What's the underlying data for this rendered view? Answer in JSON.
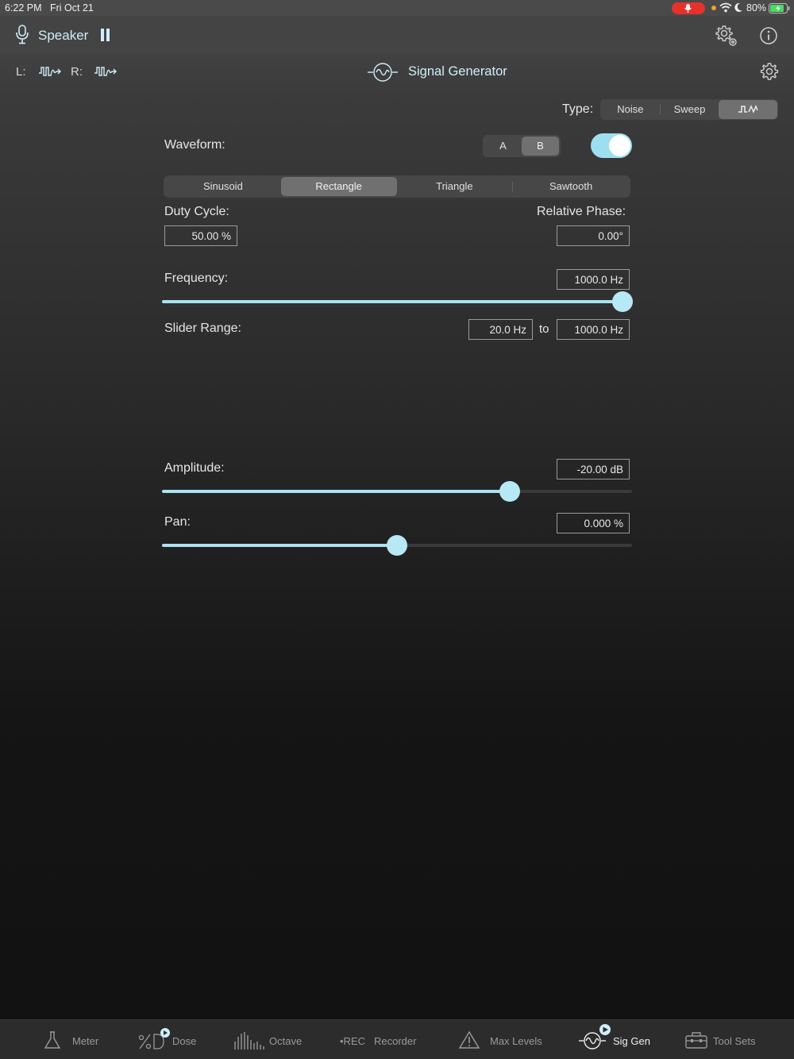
{
  "status_bar": {
    "time": "6:22 PM",
    "date": "Fri Oct 21",
    "battery": "80%"
  },
  "top_bar": {
    "output_label": "Speaker"
  },
  "sub_bar": {
    "left_label": "L:",
    "right_label": "R:",
    "title": "Signal Generator"
  },
  "type": {
    "label": "Type:",
    "options": [
      "Noise",
      "Sweep",
      "waveform-icon"
    ],
    "selected": 2
  },
  "waveform": {
    "label": "Waveform:",
    "ab_options": [
      "A",
      "B"
    ],
    "ab_selected": 1,
    "enabled": true,
    "shapes": [
      "Sinusoid",
      "Rectangle",
      "Triangle",
      "Sawtooth"
    ],
    "shape_selected": 1
  },
  "duty_cycle": {
    "label": "Duty Cycle:",
    "value": "50.00 %"
  },
  "relative_phase": {
    "label": "Relative Phase:",
    "value": "0.00°"
  },
  "frequency": {
    "label": "Frequency:",
    "value": "1000.0 Hz",
    "slider_fraction": 0.98
  },
  "slider_range": {
    "label": "Slider Range:",
    "from": "20.0 Hz",
    "to_label": "to",
    "to": "1000.0 Hz"
  },
  "amplitude": {
    "label": "Amplitude:",
    "value": "-20.00 dB",
    "slider_fraction": 0.74
  },
  "pan": {
    "label": "Pan:",
    "value": "0.000 %",
    "slider_fraction": 0.5
  },
  "tabs": [
    {
      "label": "Meter",
      "icon": "meter-icon"
    },
    {
      "label": "Dose",
      "icon": "dose-icon"
    },
    {
      "label": "Octave",
      "icon": "octave-icon"
    },
    {
      "label": "Recorder",
      "icon": "rec-icon",
      "prefix": "•REC"
    },
    {
      "label": "Max Levels",
      "icon": "max-levels-icon"
    },
    {
      "label": "Sig Gen",
      "icon": "sig-gen-icon",
      "active": true
    },
    {
      "label": "Tool Sets",
      "icon": "toolbox-icon"
    }
  ],
  "colors": {
    "accent": "#a9e3f2",
    "record_red": "#e5322d"
  }
}
